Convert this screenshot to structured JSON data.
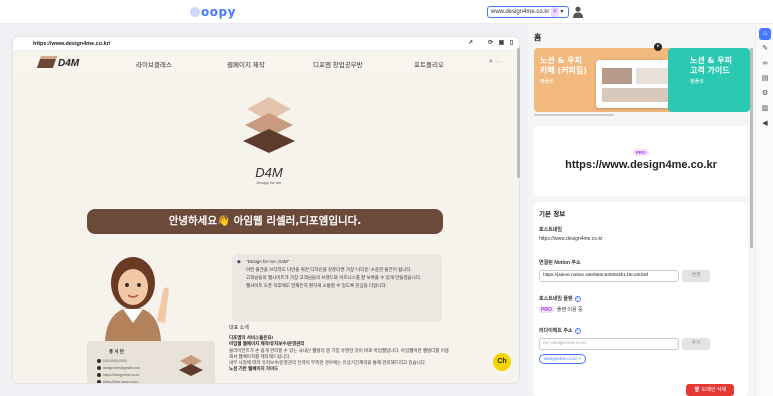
{
  "app": {
    "logo": "oopy"
  },
  "topbar": {
    "site_select": "www.design4me.co.kr",
    "site_badge": "P",
    "user_icon": "user-icon"
  },
  "browser": {
    "url": "https://www.design4me.co.kr/",
    "icons": [
      "open-new-icon",
      "refresh-icon",
      "desktop-icon",
      "mobile-icon"
    ]
  },
  "site": {
    "logo_text": "D4M",
    "nav": [
      "라이브클래스",
      "웹페이지 제작",
      "디포엠 창업공부방",
      "포트폴리오"
    ],
    "hero_text": "D4M",
    "hero_sub": "Design for me",
    "banner": "안녕하세요👋 아임웹 리셀러,디포엠입니다.",
    "quote": [
      "\"Design for me, D4M\"",
      "어떤 물건을 쓰더라도 나만을 위한 디자인을 갖춘다면 가장 '나다운' 소중한 물건이 됩니다.",
      "고객님들의 웹사이트가 가장 고객님들의 브랜드와 비즈니스를 잘 보여줄 수 있게 만들겠습니다.",
      "웹사이트 오픈 이후에도 언제든지 편하게 소통할 수 있도록 진심을 다합니다."
    ],
    "intro_title": "대표 소개",
    "intro": [
      {
        "text": "디포엠의 서비스들은요!",
        "bold": true
      },
      {
        "text": "아임웹 웹페이지 제작/유지보수/운영관리",
        "bold": true
      },
      {
        "text": "클라이언트가 손 쉽게 관리할 수 있는 국내산 웹빌더 중 가장 유명한 것이 바로 아임웹입니다. 아임웹이란 웹빌더를 이용해서 웹페이지를 제작해드립니다.",
        "bold": false
      },
      {
        "text": "내부 사정에 따라 유지보수/운영관리 인력이 부족한 경우에는 유상기간계약을 통해 관리해드리고 있습니다.",
        "bold": false
      },
      {
        "text": "노션 기반 웹페이지 가이드",
        "bold": true
      }
    ],
    "card_name": "홍 서 연",
    "card_lines": [
      "010-0000-0000",
      "design4me@gmail.com",
      "https://design4me.co.kr",
      "https://blog.naver.com/..."
    ],
    "chat_label": "Ch"
  },
  "panel": {
    "title": "홈",
    "promo1": {
      "line1": "노션 & 우피",
      "line2": "카페 (커피집)",
      "sub": "템플릿"
    },
    "promo2": {
      "line1": "노션 & 우피",
      "line2": "고객 가이드",
      "sub": "템플릿"
    },
    "pro_badge": "PRO",
    "pro_url": "https://www.design4me.co.kr",
    "info": {
      "heading": "기본 정보",
      "host_label": "호스트네임",
      "host_value": "https://www.design4me.co.kr",
      "notion_label": "연결된 Notion 주소",
      "notion_value": "https://jsieve.notion.site/683c940063b145c18cb6f",
      "notion_btn": "변경",
      "plan_label": "호스트네임 플랜",
      "plan_badge": "PRO",
      "plan_text": "플랜 이용 중",
      "redirect_label": "리다이렉트 주소",
      "redirect_placeholder": "ex) design4me.co.kr",
      "redirect_btn": "추가",
      "chip": "design4me.co.kr",
      "delete_btn": "도메인 삭제"
    }
  },
  "rail": [
    "home-icon",
    "tool-icon",
    "link-icon",
    "file-icon",
    "wrench-icon",
    "chart-icon",
    "megaphone-icon"
  ],
  "colors": {
    "accent": "#4a78ff",
    "banner": "#6b4a3a",
    "pro": "#a23be0",
    "danger": "#e53935"
  }
}
